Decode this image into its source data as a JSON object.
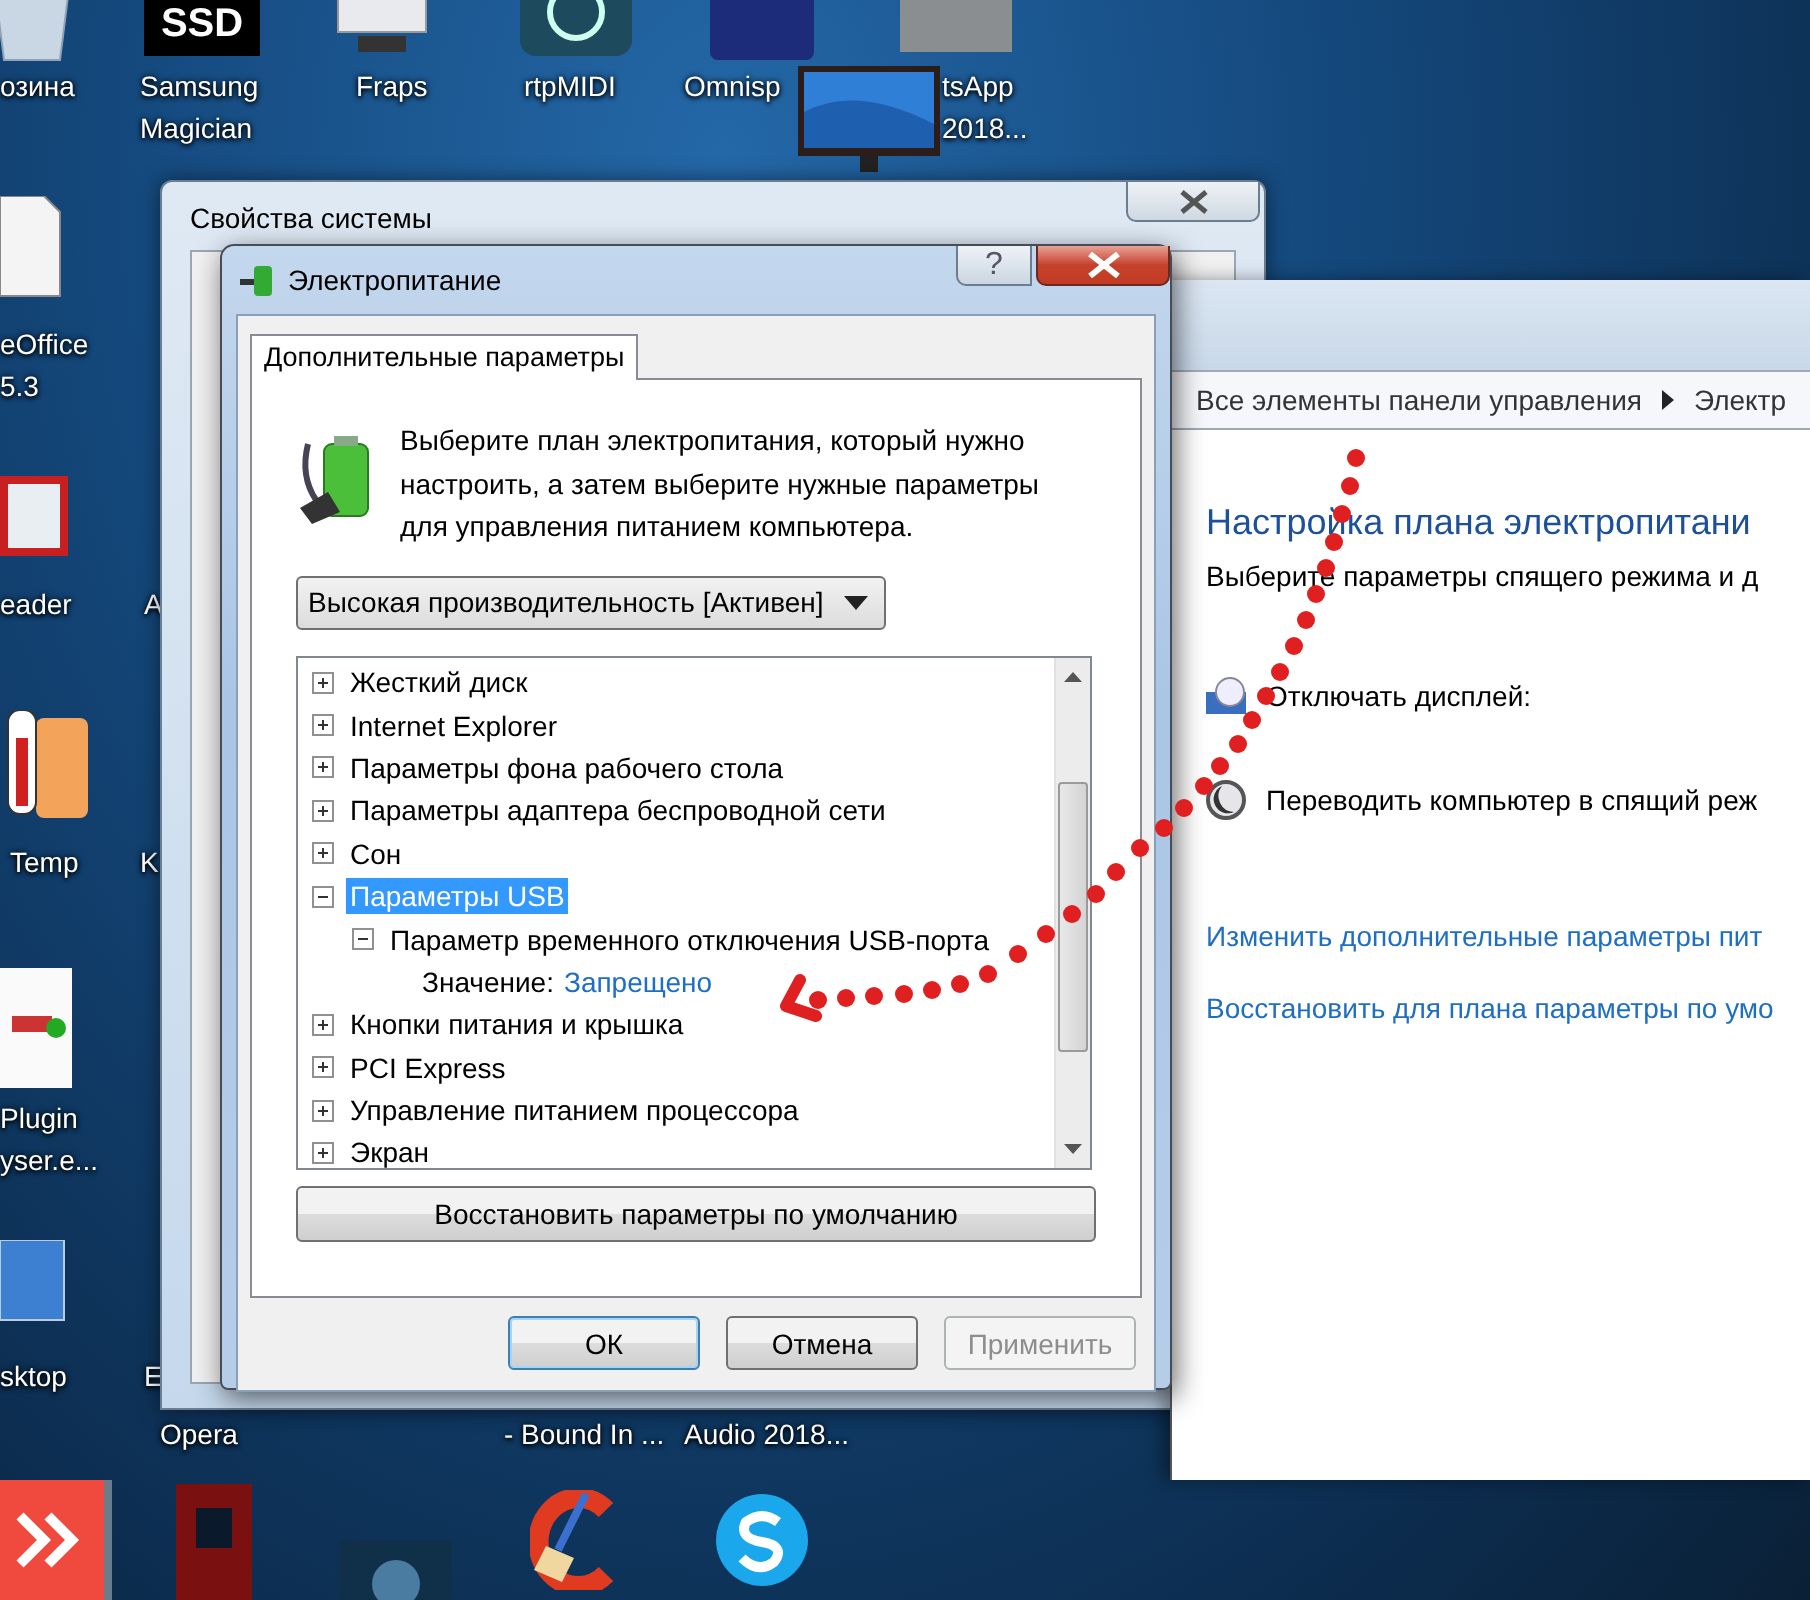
{
  "desktop": {
    "top_icons": [
      {
        "lines": [
          "озина"
        ]
      },
      {
        "lines": [
          "Samsung",
          "Magician"
        ],
        "icon_text": "SSD"
      },
      {
        "lines": [
          "Fraps"
        ]
      },
      {
        "lines": [
          "rtpMIDI"
        ]
      },
      {
        "lines": [
          "Omnisp"
        ]
      },
      {
        "lines": [
          "tsApp",
          "2018..."
        ]
      }
    ],
    "left_icons": [
      {
        "lines": [
          "eOffice",
          "5.3"
        ]
      },
      {
        "lines": [
          "eader"
        ]
      },
      {
        "lines": [
          "Temp"
        ]
      },
      {
        "lines": [
          "Plugin",
          "yser.e..."
        ]
      },
      {
        "lines": [
          "sktop"
        ]
      }
    ],
    "second_column_labels": [
      {
        "lines": [
          "A"
        ]
      },
      {
        "lines": [
          "K"
        ]
      },
      {
        "lines": [
          "E"
        ]
      }
    ],
    "bottom_labels": [
      {
        "lines": [
          "Opera"
        ]
      },
      {
        "lines": [
          "- Bound In ..."
        ]
      },
      {
        "lines": [
          "Audio 2018..."
        ]
      }
    ]
  },
  "system_properties_window": {
    "title": "Свойства системы"
  },
  "control_panel_window": {
    "breadcrumb": [
      "Все элементы панели управления",
      "Электр"
    ],
    "heading": "Настройка плана электропитани",
    "subtitle": "Выберите параметры спящего режима и д",
    "settings": [
      {
        "kind": "display",
        "label": "Отключать дисплей:"
      },
      {
        "kind": "sleep",
        "label": "Переводить компьютер в спящий реж"
      }
    ],
    "links": [
      "Изменить дополнительные параметры пит",
      "Восстановить для плана параметры по умо"
    ]
  },
  "power_options_dialog": {
    "title": "Электропитание",
    "help_button": "?",
    "tabs": [
      {
        "label": "Дополнительные параметры",
        "selected": true
      }
    ],
    "description": "Выберите план электропитания, который нужно настроить, а затем выберите нужные параметры для управления питанием компьютера.",
    "plan_dropdown": {
      "value": "Высокая производительность [Активен]"
    },
    "settings_tree": [
      {
        "label": "Жесткий диск",
        "expanded": false,
        "selected": false
      },
      {
        "label": "Internet Explorer",
        "expanded": false,
        "selected": false
      },
      {
        "label": "Параметры фона рабочего стола",
        "expanded": false,
        "selected": false
      },
      {
        "label": "Параметры адаптера беспроводной сети",
        "expanded": false,
        "selected": false
      },
      {
        "label": "Сон",
        "expanded": false,
        "selected": false
      },
      {
        "label": "Параметры USB",
        "expanded": true,
        "selected": true,
        "children": [
          {
            "label": "Параметр временного отключения USB-порта",
            "expanded": true,
            "selected": false,
            "setting": {
              "label": "Значение:",
              "value": "Запрещено"
            }
          }
        ]
      },
      {
        "label": "Кнопки питания и крышка",
        "expanded": false,
        "selected": false
      },
      {
        "label": "PCI Express",
        "expanded": false,
        "selected": false
      },
      {
        "label": "Управление питанием процессора",
        "expanded": false,
        "selected": false
      },
      {
        "label": "Экран",
        "expanded": false,
        "selected": false
      }
    ],
    "restore_button": "Восстановить параметры по умолчанию",
    "buttons": [
      {
        "label": "ОК",
        "default": true,
        "disabled": false
      },
      {
        "label": "Отмена",
        "default": false,
        "disabled": false
      },
      {
        "label": "Применить",
        "default": false,
        "disabled": true
      }
    ]
  }
}
